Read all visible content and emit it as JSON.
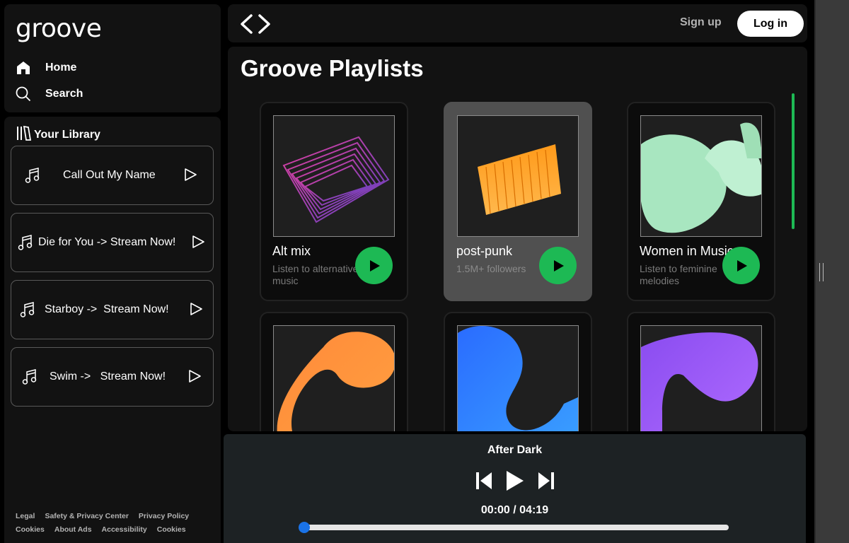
{
  "app": {
    "logo": "groove"
  },
  "nav": {
    "home": "Home",
    "search": "Search"
  },
  "library": {
    "title": "Your Library",
    "items": [
      {
        "label": "Call Out My Name"
      },
      {
        "label": "Die for You -> Stream Now!"
      },
      {
        "label": "Starboy ->  Stream Now!"
      },
      {
        "label": "Swim ->   Stream Now!"
      }
    ]
  },
  "footer": {
    "row1": [
      "Legal",
      "Safety & Privacy Center",
      "Privacy Policy"
    ],
    "row2": [
      "Cookies",
      "About Ads",
      "Accessibility",
      "Cookies"
    ]
  },
  "topbar": {
    "signup": "Sign up",
    "login": "Log in"
  },
  "main": {
    "title": "Groove Playlists",
    "cards": [
      {
        "name": "Alt mix",
        "desc": "Listen to alternative music"
      },
      {
        "name": "post-punk",
        "desc": "1.5M+ followers"
      },
      {
        "name": "Women in Music",
        "desc": "Listen to feminine melodies"
      },
      {
        "name": "",
        "desc": ""
      },
      {
        "name": "",
        "desc": ""
      },
      {
        "name": "",
        "desc": ""
      }
    ]
  },
  "player": {
    "track": "After Dark",
    "time": "00:00 / 04:19",
    "progress": 0
  },
  "colors": {
    "accent": "#1db954",
    "background": "#000000",
    "panel": "#121212",
    "knob": "#1a73e8"
  }
}
